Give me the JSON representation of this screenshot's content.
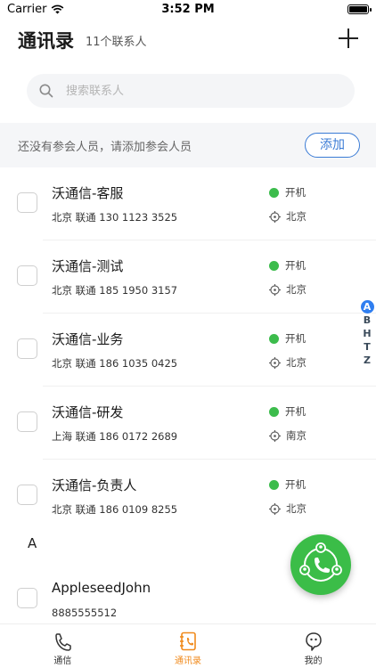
{
  "status_bar": {
    "carrier": "Carrier",
    "time": "3:52 PM"
  },
  "header": {
    "title": "通讯录",
    "count": "11个联系人"
  },
  "search": {
    "placeholder": "搜索联系人"
  },
  "notice": {
    "text": "还没有参会人员，请添加参会人员",
    "button": "添加"
  },
  "contacts": [
    {
      "name": "沃通信-客服",
      "meta": "北京 联通   130 1123 3525",
      "status": "开机",
      "location": "北京"
    },
    {
      "name": "沃通信-测试",
      "meta": "北京 联通   185 1950 3157",
      "status": "开机",
      "location": "北京"
    },
    {
      "name": "沃通信-业务",
      "meta": "北京 联通   186 1035 0425",
      "status": "开机",
      "location": "北京"
    },
    {
      "name": "沃通信-研发",
      "meta": "上海 联通   186 0172 2689",
      "status": "开机",
      "location": "南京"
    },
    {
      "name": "沃通信-负责人",
      "meta": "北京 联通   186 0109 8255",
      "status": "开机",
      "location": "北京"
    }
  ],
  "section_a": {
    "letter": "A",
    "contact": {
      "name": "AppleseedJohn",
      "meta": "8885555512"
    }
  },
  "index": [
    "A",
    "B",
    "H",
    "T",
    "Z"
  ],
  "tabs": [
    {
      "label": "通信",
      "icon": "phone-icon"
    },
    {
      "label": "通讯录",
      "icon": "contacts-book-icon"
    },
    {
      "label": "我的",
      "icon": "profile-icon"
    }
  ],
  "colors": {
    "accent_blue": "#3a7bd5",
    "status_green": "#3cbc4c",
    "tab_active": "#f08a1c",
    "fab_green": "#3bbd48"
  }
}
